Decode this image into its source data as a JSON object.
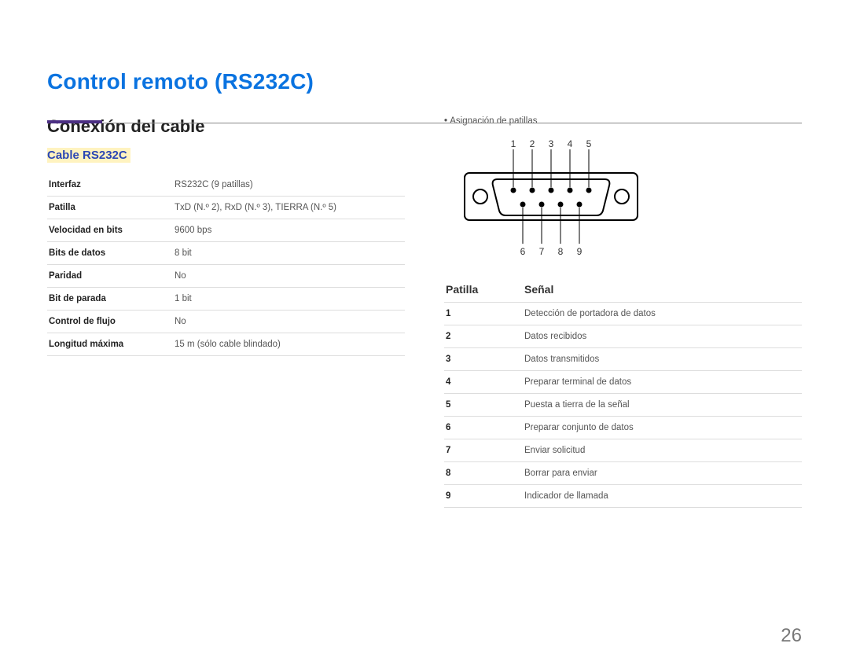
{
  "title": "Control remoto (RS232C)",
  "section_title": "Conexión del cable",
  "cable_heading": "Cable RS232C",
  "spec_rows": [
    {
      "label": "Interfaz",
      "value": "RS232C (9 patillas)"
    },
    {
      "label": "Patilla",
      "value": "TxD (N.º 2), RxD (N.º 3), TIERRA (N.º 5)"
    },
    {
      "label": "Velocidad en bits",
      "value": "9600 bps"
    },
    {
      "label": "Bits de datos",
      "value": "8 bit"
    },
    {
      "label": "Paridad",
      "value": "No"
    },
    {
      "label": "Bit de parada",
      "value": "1 bit"
    },
    {
      "label": "Control de flujo",
      "value": "No"
    },
    {
      "label": "Longitud máxima",
      "value": "15 m (sólo cable blindado)"
    }
  ],
  "pin_assignment_label": "Asignación de patillas",
  "pin_numbers_top": [
    "1",
    "2",
    "3",
    "4",
    "5"
  ],
  "pin_numbers_bottom": [
    "6",
    "7",
    "8",
    "9"
  ],
  "pin_table_headers": {
    "pin": "Patilla",
    "signal": "Señal"
  },
  "pin_rows": [
    {
      "pin": "1",
      "signal": "Detección de portadora de datos"
    },
    {
      "pin": "2",
      "signal": "Datos recibidos"
    },
    {
      "pin": "3",
      "signal": "Datos transmitidos"
    },
    {
      "pin": "4",
      "signal": "Preparar terminal de datos"
    },
    {
      "pin": "5",
      "signal": "Puesta a tierra de la señal"
    },
    {
      "pin": "6",
      "signal": "Preparar conjunto de datos"
    },
    {
      "pin": "7",
      "signal": "Enviar solicitud"
    },
    {
      "pin": "8",
      "signal": "Borrar para enviar"
    },
    {
      "pin": "9",
      "signal": "Indicador de llamada"
    }
  ],
  "page_number": "26"
}
